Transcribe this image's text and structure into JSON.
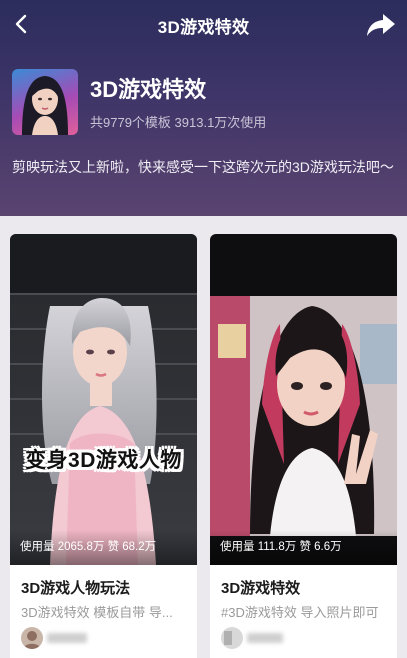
{
  "nav": {
    "title": "3D游戏特效",
    "back_icon": "chevron-left-icon",
    "share_icon": "share-arrow-icon"
  },
  "topic": {
    "title": "3D游戏特效",
    "stats": "共9779个模板 3913.1万次使用",
    "description": "剪映玩法又上新啦，快来感受一下这跨次元的3D游戏玩法吧～"
  },
  "cards": [
    {
      "overlay_text": "变身3D游戏人物",
      "usage": "使用量 2065.8万 赞 68.2万",
      "title": "3D游戏人物玩法",
      "subtitle": "3D游戏特效 模板自带 导...",
      "author_name": ""
    },
    {
      "usage": "使用量 111.8万 赞 6.6万",
      "title": "3D游戏特效",
      "subtitle": "#3D游戏特效 导入照片即可",
      "author_name": ""
    }
  ],
  "colors": {
    "hero_top": "#2b2d5c",
    "hero_bottom": "#5a4470",
    "page_bg": "#ece9ee",
    "card_bg": "#ffffff"
  }
}
